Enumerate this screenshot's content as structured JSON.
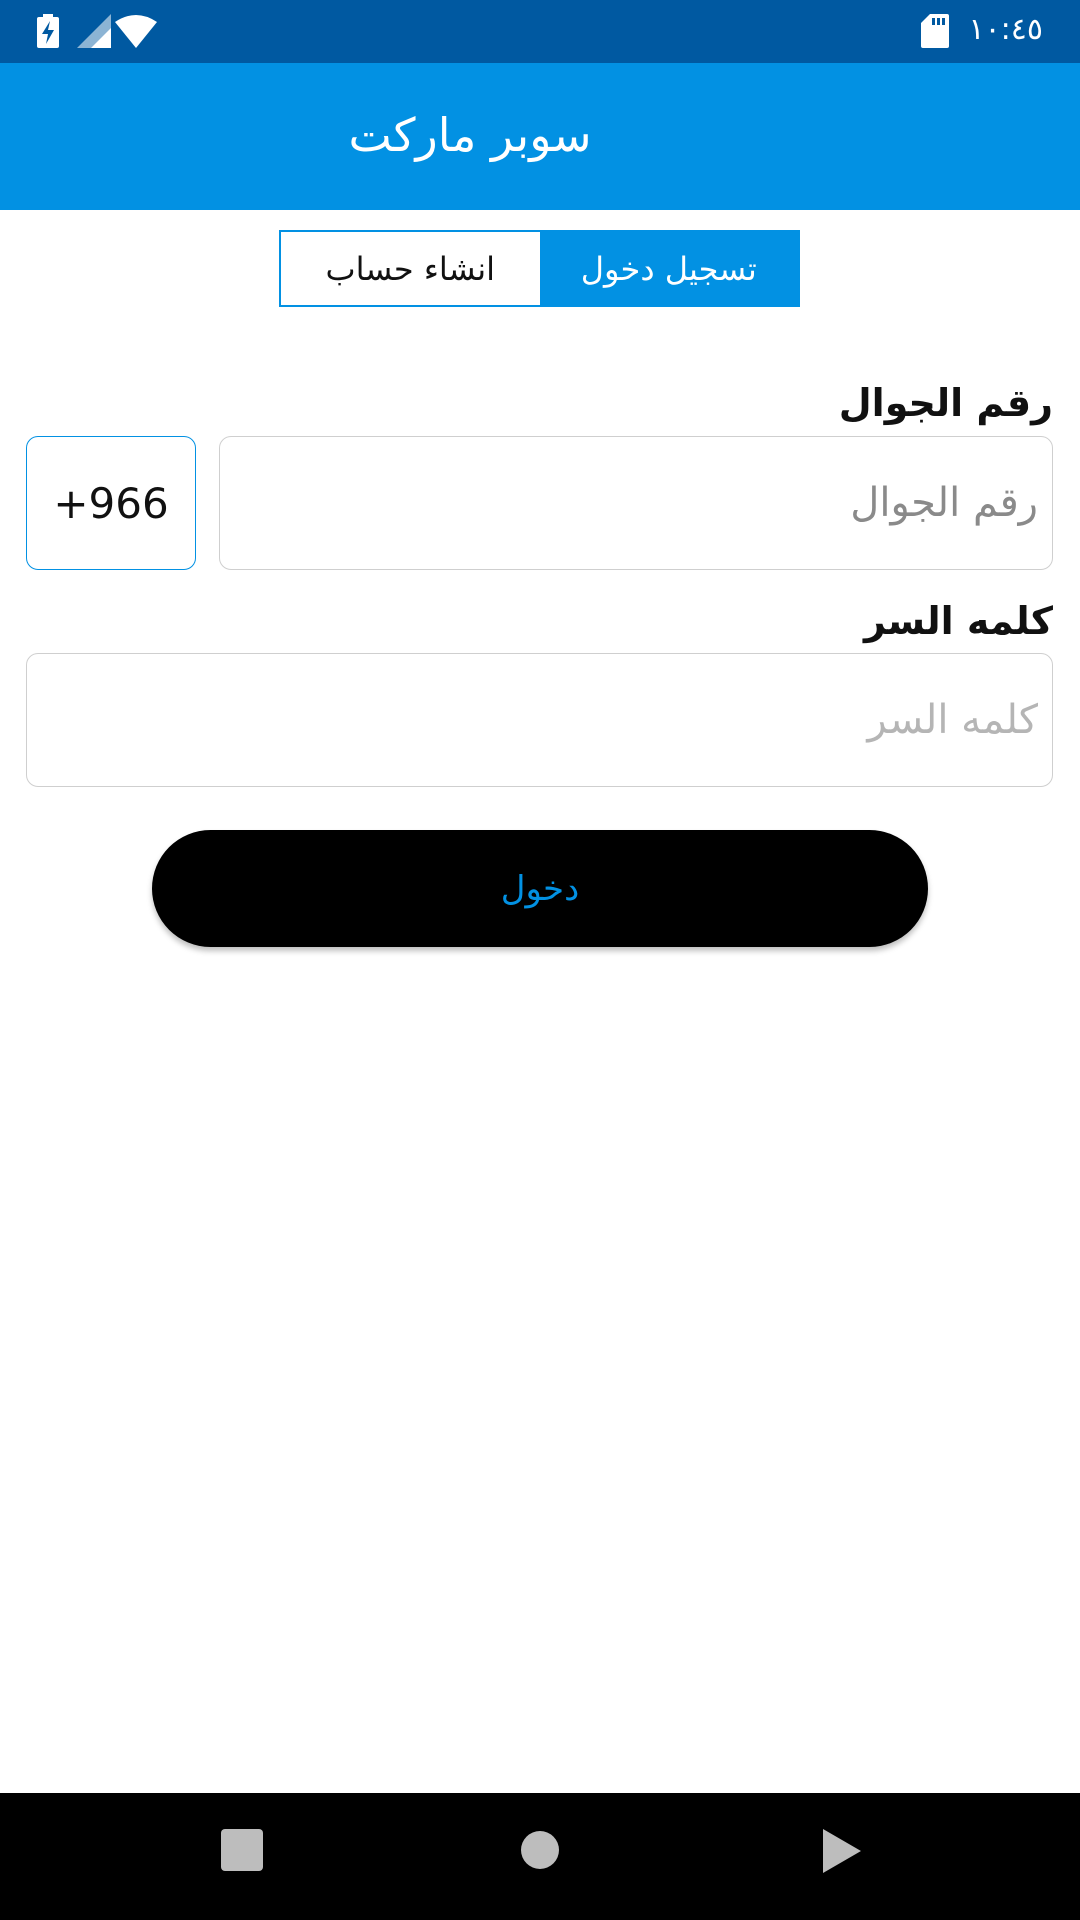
{
  "status_bar": {
    "time": "١٠:٤٥",
    "icons": [
      "battery-charging-icon",
      "signal-icon",
      "wifi-icon",
      "sd-card-icon"
    ],
    "background": "#0059a1"
  },
  "app_bar": {
    "title": "سوبر ماركت",
    "background": "#0291e3"
  },
  "tabs": {
    "register_label": "انشاء حساب",
    "login_label": "تسجيل دخول",
    "selected": "login"
  },
  "form": {
    "phone_label": "رقم الجوال",
    "phone_placeholder": "رقم الجوال",
    "phone_value": "",
    "country_code": "+966",
    "password_label": "كلمه السر",
    "password_placeholder": "كلمه السر",
    "password_value": ""
  },
  "login_button": {
    "label": "دخول"
  },
  "nav_bar": {
    "icons": [
      "recents-icon",
      "home-icon",
      "back-icon"
    ]
  },
  "colors": {
    "accent": "#0291e3",
    "status_bar": "#0059a1",
    "button_bg": "#000000"
  }
}
